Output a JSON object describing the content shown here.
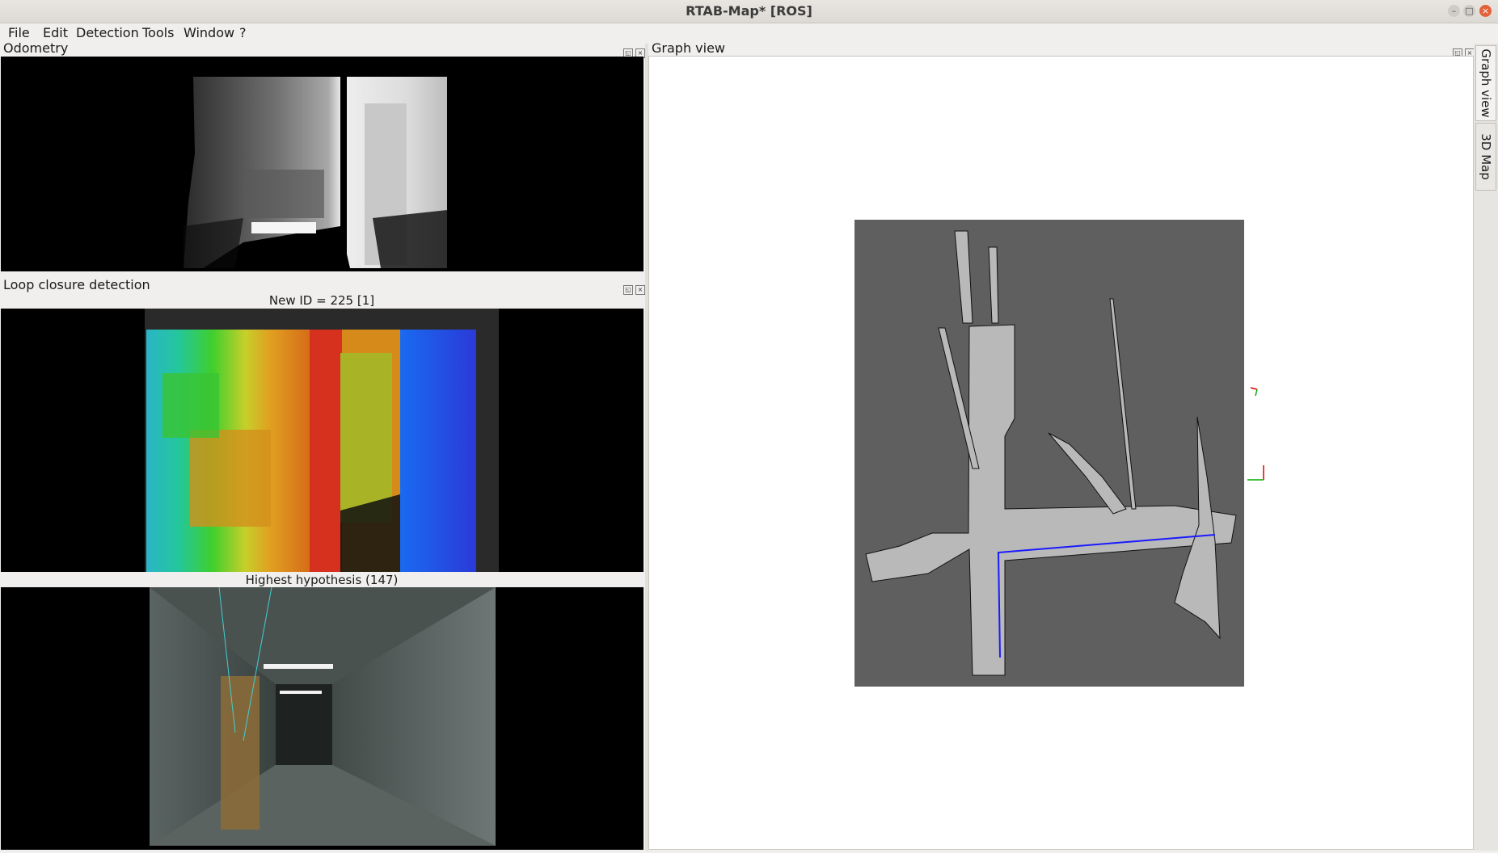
{
  "window": {
    "title": "RTAB-Map* [ROS]"
  },
  "menu": [
    "File",
    "Edit",
    "Detection",
    "Tools",
    "Window",
    "?"
  ],
  "docks": {
    "odometry": {
      "title": "Odometry"
    },
    "loop_closure": {
      "title": "Loop closure detection",
      "new_id_caption": "New ID = 225 [1]",
      "hypothesis_caption": "Highest hypothesis (147)"
    },
    "graph": {
      "title": "Graph view"
    }
  },
  "side_tabs": [
    "Graph view",
    "3D Map"
  ],
  "icons": {
    "float": "float-icon",
    "close": "close-icon"
  },
  "colors": {
    "map_background": "#5f5f5f",
    "map_free": "#b9b9b9",
    "trajectory": "#1a1aff"
  }
}
